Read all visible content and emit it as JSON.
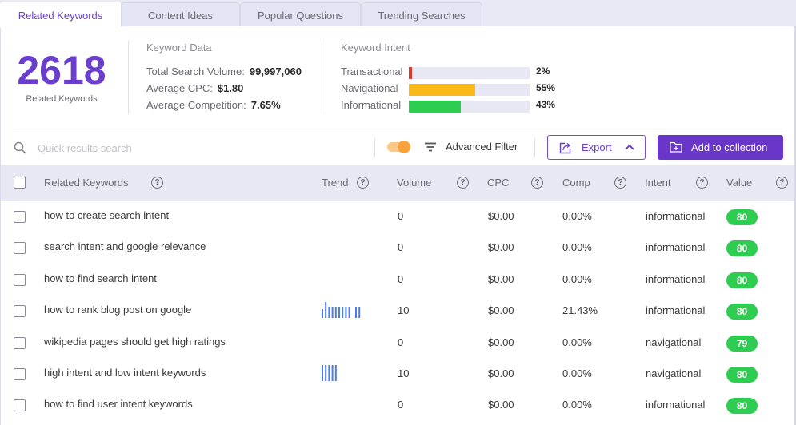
{
  "tabs": [
    {
      "label": "Related Keywords",
      "active": true
    },
    {
      "label": "Content Ideas",
      "active": false
    },
    {
      "label": "Popular Questions",
      "active": false
    },
    {
      "label": "Trending Searches",
      "active": false
    }
  ],
  "summary": {
    "count": "2618",
    "count_label": "Related Keywords",
    "keyword_data_title": "Keyword Data",
    "total_search_volume_label": "Total Search Volume:",
    "total_search_volume": "99,997,060",
    "avg_cpc_label": "Average CPC:",
    "avg_cpc": "$1.80",
    "avg_competition_label": "Average Competition:",
    "avg_competition": "7.65%",
    "intent_title": "Keyword Intent",
    "intents": [
      {
        "label": "Transactional",
        "percent": 2,
        "percent_text": "2%",
        "color": "#d93a2b"
      },
      {
        "label": "Navigational",
        "percent": 55,
        "percent_text": "55%",
        "color": "#fbb917"
      },
      {
        "label": "Informational",
        "percent": 43,
        "percent_text": "43%",
        "color": "#2ecc50"
      }
    ]
  },
  "toolbar": {
    "search_placeholder": "Quick results search",
    "search_value": "",
    "toggle_on": true,
    "advanced_filter_label": "Advanced Filter",
    "export_label": "Export",
    "add_collection_label": "Add to collection"
  },
  "table": {
    "columns": {
      "keyword": "Related Keywords",
      "trend": "Trend",
      "volume": "Volume",
      "cpc": "CPC",
      "comp": "Comp",
      "intent": "Intent",
      "value": "Value"
    },
    "trend_color": "#4c7de8",
    "rows": [
      {
        "keyword": "how to create search intent",
        "trend": [],
        "volume": "0",
        "cpc": "$0.00",
        "comp": "0.00%",
        "intent": "informational",
        "value": "80"
      },
      {
        "keyword": "search intent and google relevance",
        "trend": [],
        "volume": "0",
        "cpc": "$0.00",
        "comp": "0.00%",
        "intent": "informational",
        "value": "80"
      },
      {
        "keyword": "how to find search intent",
        "trend": [],
        "volume": "0",
        "cpc": "$0.00",
        "comp": "0.00%",
        "intent": "informational",
        "value": "80"
      },
      {
        "keyword": "how to rank blog post on google",
        "trend": [
          0.55,
          1,
          0.7,
          0.7,
          0.7,
          0.7,
          0.7,
          0.7,
          0.7,
          0,
          0.7,
          0.7
        ],
        "volume": "10",
        "cpc": "$0.00",
        "comp": "21.43%",
        "intent": "informational",
        "value": "80"
      },
      {
        "keyword": "wikipedia pages should get high ratings",
        "trend": [],
        "volume": "0",
        "cpc": "$0.00",
        "comp": "0.00%",
        "intent": "navigational",
        "value": "79"
      },
      {
        "keyword": "high intent and low intent keywords",
        "trend": [
          1,
          1,
          1,
          1,
          1
        ],
        "volume": "10",
        "cpc": "$0.00",
        "comp": "0.00%",
        "intent": "navigational",
        "value": "80"
      },
      {
        "keyword": "how to find user intent keywords",
        "trend": [],
        "volume": "0",
        "cpc": "$0.00",
        "comp": "0.00%",
        "intent": "informational",
        "value": "80"
      }
    ]
  }
}
